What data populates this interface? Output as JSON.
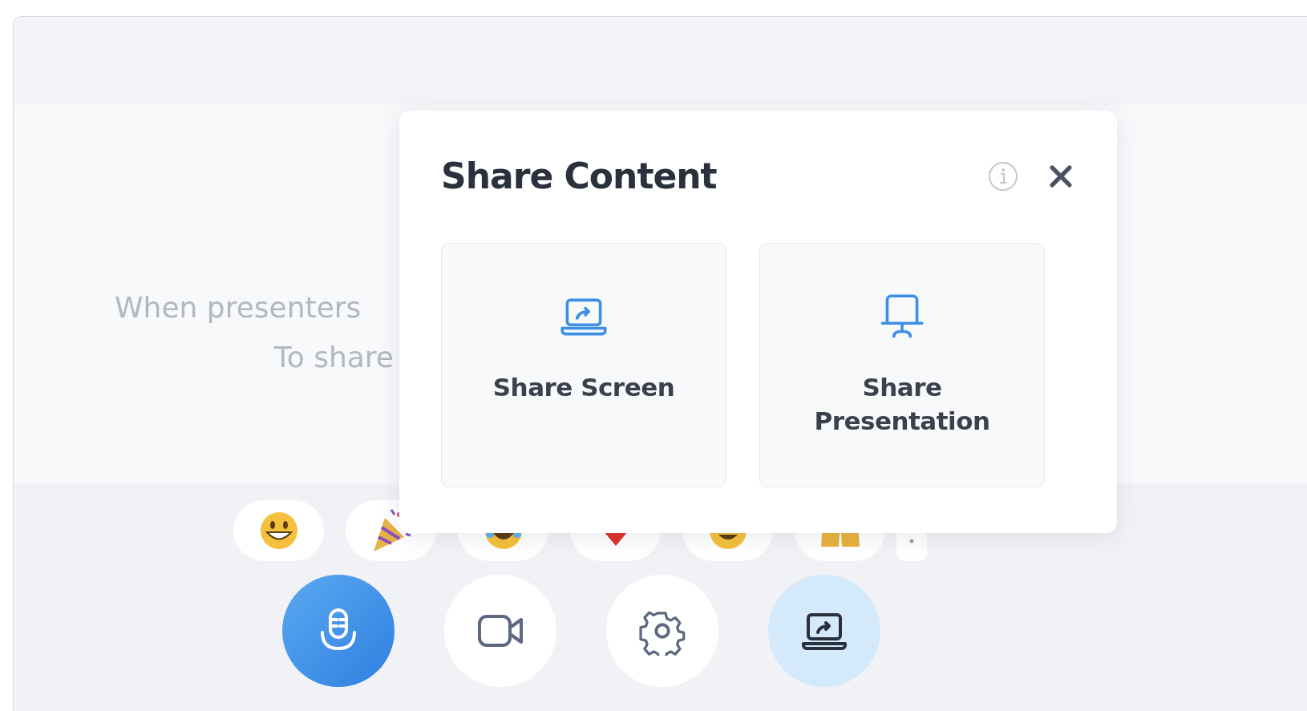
{
  "background_text": [
    "When presenters",
    "To share"
  ],
  "reactions": [
    {
      "kind": "grin"
    },
    {
      "kind": "party"
    },
    {
      "kind": "laugh"
    },
    {
      "kind": "heart"
    },
    {
      "kind": "heart-eyes"
    },
    {
      "kind": "raised-hands"
    },
    {
      "kind": "more"
    }
  ],
  "controls": [
    {
      "kind": "mic",
      "active": true
    },
    {
      "kind": "camera",
      "active": false
    },
    {
      "kind": "settings",
      "active": false
    },
    {
      "kind": "share",
      "active": true
    }
  ],
  "dialog": {
    "title": "Share Content",
    "options": [
      {
        "kind": "screen",
        "label": "Share Screen"
      },
      {
        "kind": "presentation",
        "label": "Share Presentation"
      }
    ]
  }
}
